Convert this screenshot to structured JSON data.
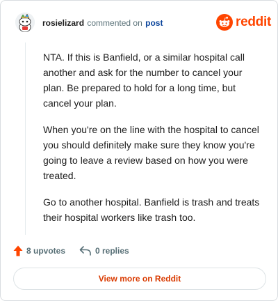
{
  "header": {
    "username": "rosielizard",
    "action_text": "commented on",
    "post_link": "post",
    "avatar_icon": "snoo-avatar-icon"
  },
  "brand": {
    "name": "reddit",
    "logo_icon": "reddit-snoo-icon",
    "color": "#ff4500"
  },
  "comment": {
    "paragraphs": [
      "NTA. If this is Banfield, or a similar hospital call another and ask for the number to cancel your plan. Be prepared to hold for a long time, but cancel your plan.",
      "When you're on the line with the hospital to cancel you should definitely make sure they know you're going to leave a review based on how you were treated.",
      "Go to another hospital. Banfield is trash and treats their hospital workers like trash too."
    ]
  },
  "actions": {
    "upvotes_label": "8 upvotes",
    "upvote_icon": "upvote-arrow-icon",
    "upvote_color": "#ff4500",
    "replies_label": "0 replies",
    "reply_icon": "reply-arrow-icon"
  },
  "footer": {
    "view_more_label": "View more on Reddit",
    "accent_color": "#d93a00"
  }
}
